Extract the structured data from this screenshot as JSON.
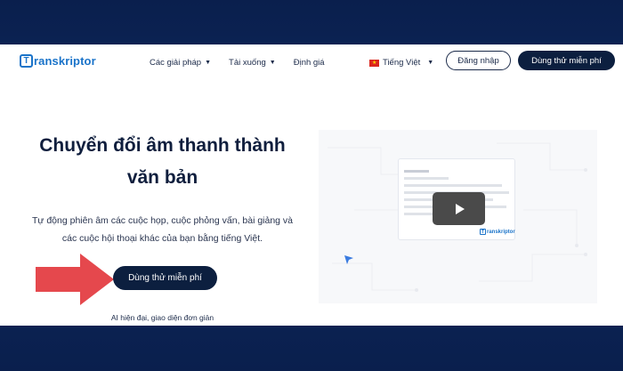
{
  "nav": {
    "logo_letter": "T",
    "logo_text": "ranskriptor",
    "links": [
      {
        "label": "Các giải pháp",
        "caret": "▼"
      },
      {
        "label": "Tải xuống",
        "caret": "▼"
      },
      {
        "label": "Định giá"
      }
    ],
    "language": {
      "label": "Tiếng Việt",
      "caret": "▼"
    },
    "login_label": "Đăng nhập",
    "trial_label": "Dùng thử miễn phí"
  },
  "hero": {
    "title_line1": "Chuyển đổi âm thanh thành",
    "title_line2": "văn bản",
    "subtitle_line1": "Tự động phiên âm các cuộc họp, cuộc phỏng vấn, bài giảng và",
    "subtitle_line2": "các cuộc hội thoại khác của bạn bằng tiếng Việt.",
    "cta_label": "Dùng thử miễn phí",
    "tagline": "AI hiện đại, giao diện đơn giản"
  },
  "video": {
    "logo_letter": "T",
    "logo_text": "ranskriptor"
  },
  "colors": {
    "brand_blue": "#1a73c9",
    "navy": "#0c1f3f",
    "arrow_red": "#e5484d",
    "background": "#0f2a60"
  },
  "icons": [
    "flag-vn-icon",
    "caret-down-icon",
    "play-icon",
    "red-arrow-icon",
    "cursor-icon"
  ]
}
